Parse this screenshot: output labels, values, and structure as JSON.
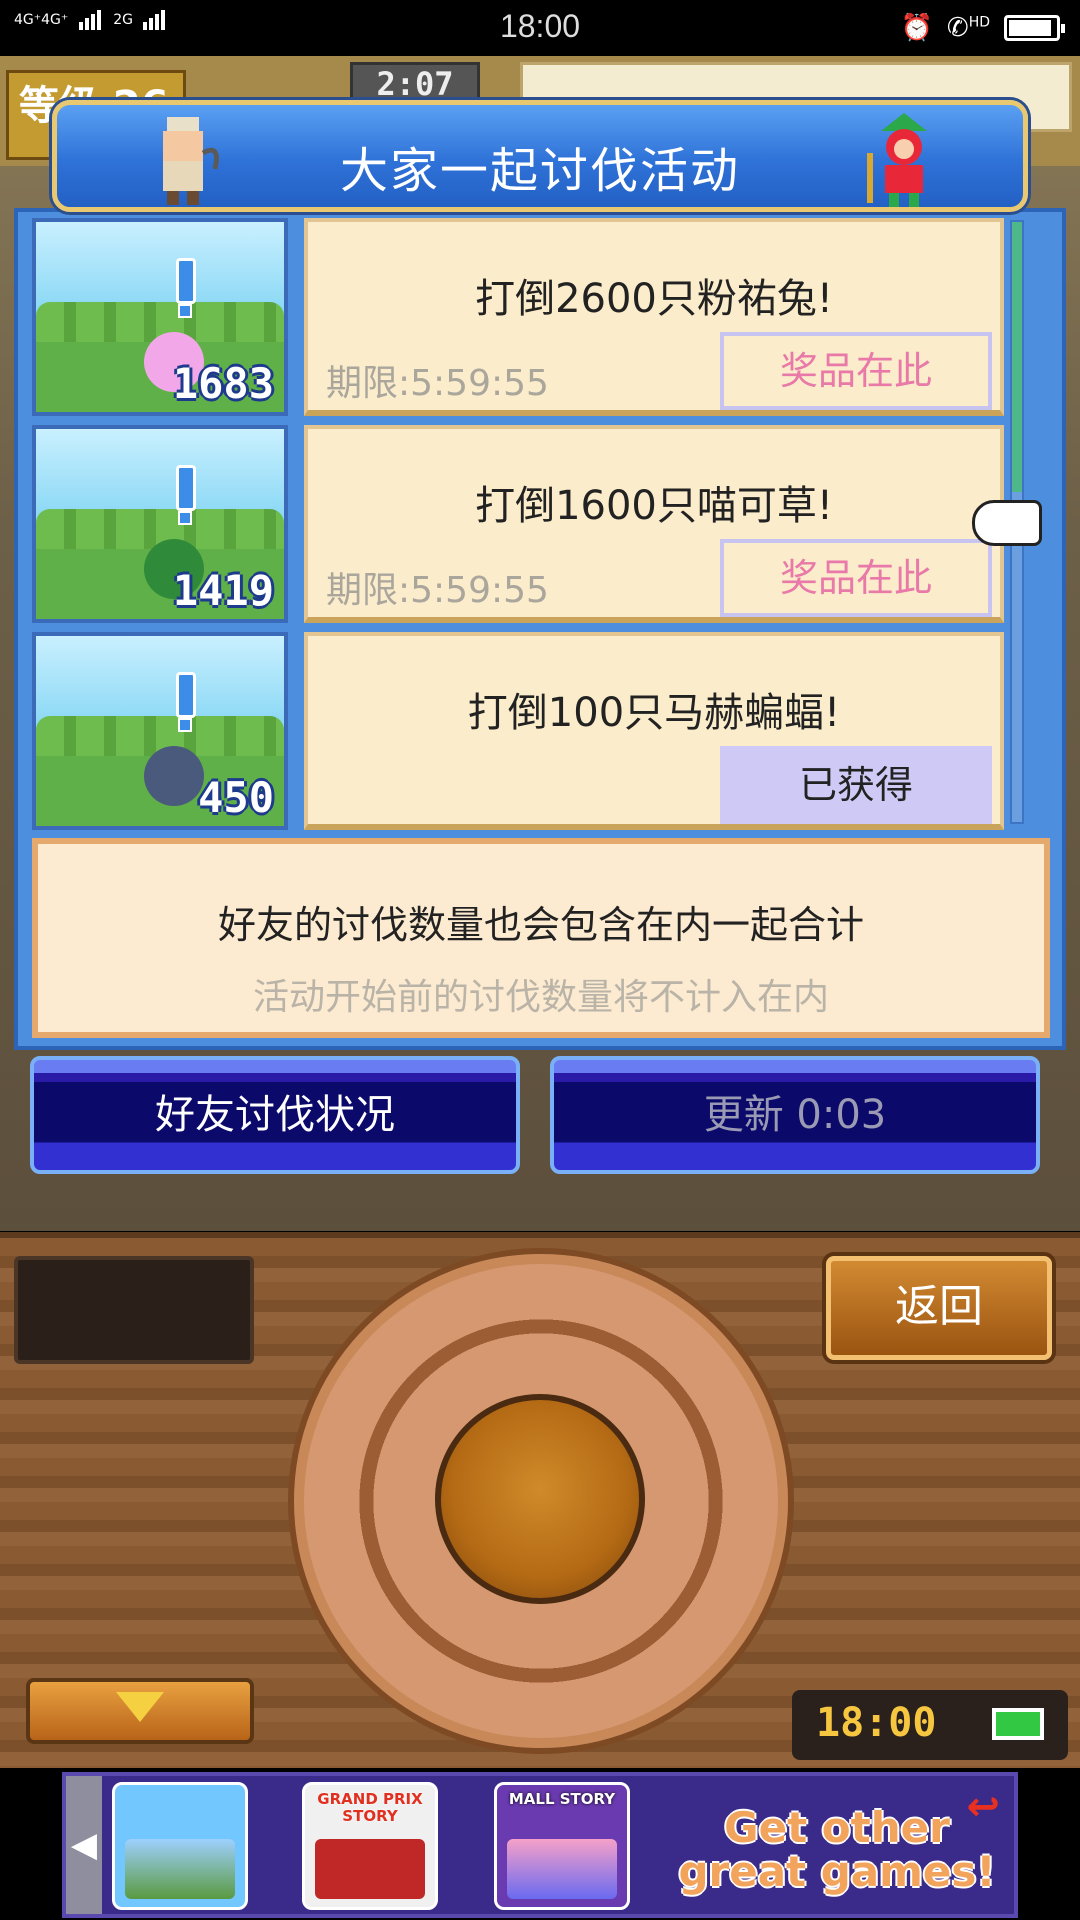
{
  "status_bar": {
    "network_1": "4G⁺4G⁺",
    "network_2": "2G",
    "time": "18:00",
    "hd_label": "HD"
  },
  "hud": {
    "level_label": "等级 26",
    "timer": "2:07"
  },
  "modal": {
    "title": "大家一起讨伐活动",
    "quests": [
      {
        "title": "打倒2600只粉祐兔!",
        "deadline": "期限:5:59:55",
        "button": "奖品在此",
        "count": "1683",
        "monster_icon": "pink-rabbit-monster-icon",
        "status": "available"
      },
      {
        "title": "打倒1600只喵可草!",
        "deadline": "期限:5:59:55",
        "button": "奖品在此",
        "count": "1419",
        "monster_icon": "plant-monster-icon",
        "status": "available"
      },
      {
        "title": "打倒100只马赫蝙蝠!",
        "deadline": "",
        "button": "已获得",
        "count": "450",
        "monster_icon": "bat-monster-icon",
        "status": "obtained"
      }
    ],
    "info_line_1": "好友的讨伐数量也会包含在内一起合计",
    "info_line_2": "活动开始前的讨伐数量将不计入在内"
  },
  "buttons": {
    "friends_status": "好友讨伐状况",
    "refresh": "更新 0:03",
    "back": "返回"
  },
  "panel": {
    "clock": "18:00"
  },
  "ad": {
    "games": [
      {
        "label": "",
        "icon": "kingdom-story-app-icon"
      },
      {
        "label": "GRAND PRIX STORY",
        "icon": "grand-prix-story-app-icon"
      },
      {
        "label": "MALL STORY",
        "icon": "mall-story-app-icon"
      }
    ],
    "tagline": "Get other great games!"
  },
  "colors": {
    "modal_blue": "#4d8fde",
    "card_bg": "#fbeccb",
    "prize_text": "#e879a8",
    "obtained_bg": "#cfcaf5",
    "clock_text": "#f7c640"
  }
}
